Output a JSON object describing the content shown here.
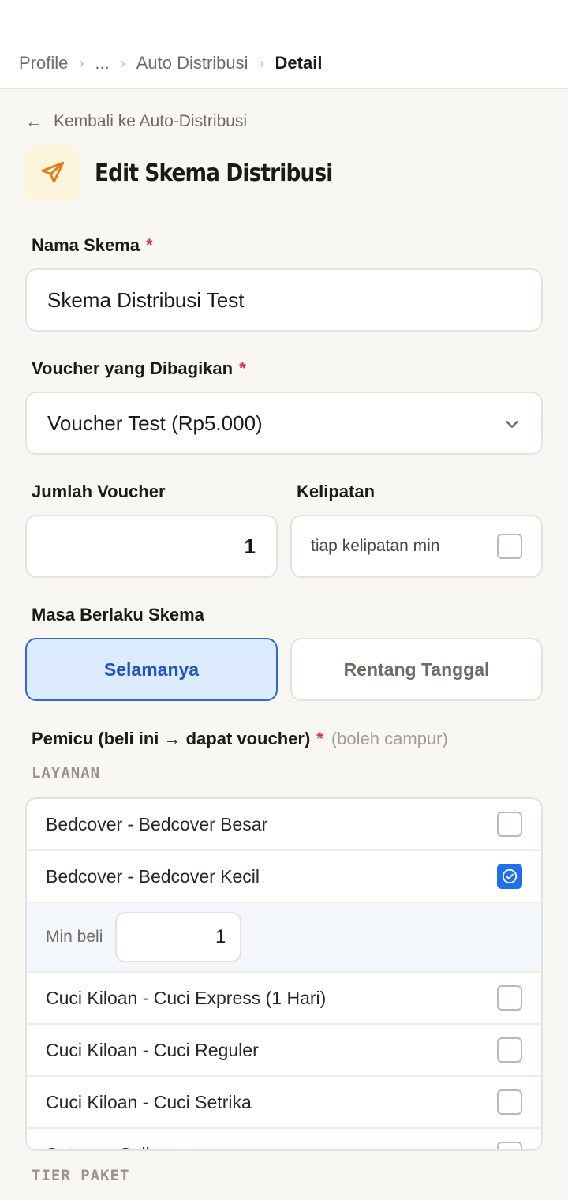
{
  "breadcrumb": [
    "Profile",
    "...",
    "Auto Distribusi",
    "Detail"
  ],
  "back_link": "Kembali ke Auto-Distribusi",
  "page_title": "Edit Skema Distribusi",
  "form": {
    "nama_skema": {
      "label": "Nama Skema",
      "required": "*",
      "value": "Skema Distribusi Test"
    },
    "voucher": {
      "label": "Voucher yang Dibagikan",
      "required": "*",
      "value": "Voucher Test (Rp5.000)"
    },
    "jumlah_voucher": {
      "label": "Jumlah Voucher",
      "value": "1"
    },
    "kelipatan": {
      "label": "Kelipatan",
      "option_text": "tiap kelipatan min",
      "checked": false
    },
    "masa_berlaku": {
      "label": "Masa Berlaku Skema",
      "options": [
        "Selamanya",
        "Rentang Tanggal"
      ],
      "selected": "Selamanya"
    },
    "pemicu": {
      "label": "Pemicu (beli ini → dapat voucher)",
      "required": "*",
      "hint": "(boleh campur)"
    }
  },
  "layanan": {
    "section_label": "LAYANAN",
    "items": [
      {
        "label": "Bedcover - Bedcover Besar",
        "checked": false
      },
      {
        "label": "Bedcover - Bedcover Kecil",
        "checked": true,
        "min_label": "Min beli",
        "min_value": "1"
      },
      {
        "label": "Cuci Kiloan - Cuci Express (1 Hari)",
        "checked": false
      },
      {
        "label": "Cuci Kiloan - Cuci Reguler",
        "checked": false
      },
      {
        "label": "Cuci Kiloan - Cuci Setrika",
        "checked": false
      },
      {
        "label": "Satuan - Selimut",
        "checked": false
      }
    ]
  },
  "tier_paket": {
    "section_label": "TIER PAKET"
  },
  "colors": {
    "accent": "#1f6feb",
    "required": "#e5254c",
    "icon": "#e27d12"
  }
}
